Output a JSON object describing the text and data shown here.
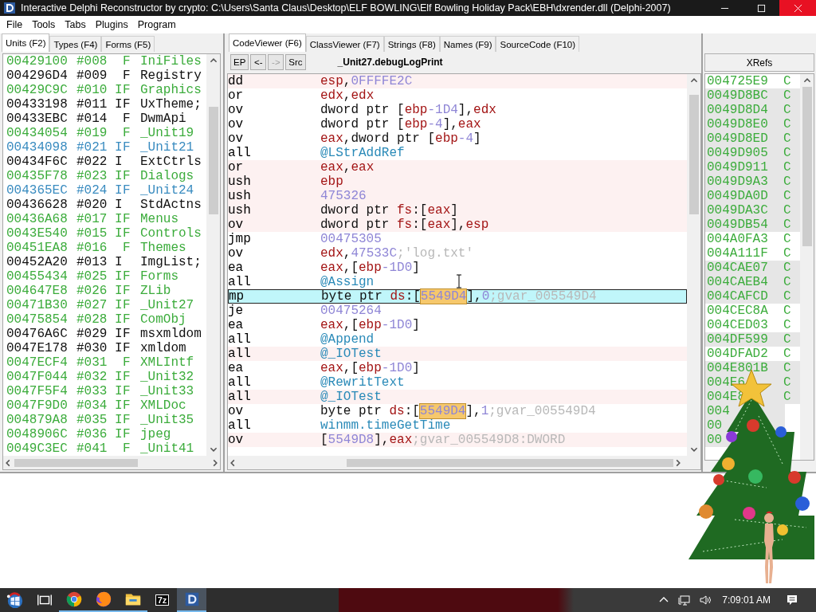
{
  "window": {
    "title": "Interactive Delphi Reconstructor by crypto: C:\\Users\\Santa Claus\\Desktop\\ELF BOWLING\\Elf Bowling Holiday Pack\\EBH\\dxrender.dll (Delphi-2007)"
  },
  "menu": [
    "File",
    "Tools",
    "Tabs",
    "Plugins",
    "Program"
  ],
  "left_tabs": [
    {
      "label": "Units (F2)",
      "selected": true
    },
    {
      "label": "Types (F4)",
      "selected": false
    },
    {
      "label": "Forms (F5)",
      "selected": false
    }
  ],
  "units": [
    {
      "address": "00429100",
      "index": "#008",
      "flag_f": "F",
      "name": "IniFiles",
      "color": "#3cac3c"
    },
    {
      "address": "004296D4",
      "index": "#009",
      "flag_f": "F",
      "name": "Registry",
      "color": "#111111"
    },
    {
      "address": "00429C9C",
      "index": "#010",
      "flag_i": "I",
      "flag_f": "F",
      "name": "Graphics",
      "color": "#3cac3c"
    },
    {
      "address": "00433198",
      "index": "#011",
      "flag_i": "I",
      "flag_f": "F",
      "name": "UxTheme;",
      "color": "#111111"
    },
    {
      "address": "00433EBC",
      "index": "#014",
      "flag_f": "F",
      "name": "DwmApi",
      "color": "#111111"
    },
    {
      "address": "00434054",
      "index": "#019",
      "flag_f": "F",
      "name": "_Unit19",
      "color": "#3cac3c"
    },
    {
      "address": "00434098",
      "index": "#021",
      "flag_i": "I",
      "flag_f": "F",
      "name": "_Unit21",
      "color": "#3a8cc0"
    },
    {
      "address": "00434F6C",
      "index": "#022",
      "flag_i": "I",
      "name": "ExtCtrls",
      "color": "#111111"
    },
    {
      "address": "00435F78",
      "index": "#023",
      "flag_i": "I",
      "flag_f": "F",
      "name": "Dialogs",
      "color": "#3cac3c"
    },
    {
      "address": "004365EC",
      "index": "#024",
      "flag_i": "I",
      "flag_f": "F",
      "name": "_Unit24",
      "color": "#3a8cc0"
    },
    {
      "address": "00436628",
      "index": "#020",
      "flag_i": "I",
      "name": "StdActns",
      "color": "#111111"
    },
    {
      "address": "00436A68",
      "index": "#017",
      "flag_i": "I",
      "flag_f": "F",
      "name": "Menus",
      "color": "#3cac3c"
    },
    {
      "address": "0043E540",
      "index": "#015",
      "flag_i": "I",
      "flag_f": "F",
      "name": "Controls",
      "color": "#3cac3c"
    },
    {
      "address": "00451EA8",
      "index": "#016",
      "flag_f": "F",
      "name": "Themes",
      "color": "#3cac3c"
    },
    {
      "address": "00452A20",
      "index": "#013",
      "flag_i": "I",
      "name": "ImgList;",
      "color": "#111111"
    },
    {
      "address": "00455434",
      "index": "#025",
      "flag_i": "I",
      "flag_f": "F",
      "name": "Forms",
      "color": "#3cac3c"
    },
    {
      "address": "004647E8",
      "index": "#026",
      "flag_i": "I",
      "flag_f": "F",
      "name": "ZLib",
      "color": "#3cac3c"
    },
    {
      "address": "00471B30",
      "index": "#027",
      "flag_i": "I",
      "flag_f": "F",
      "name": "_Unit27",
      "color": "#3cac3c"
    },
    {
      "address": "00475854",
      "index": "#028",
      "flag_i": "I",
      "flag_f": "F",
      "name": "ComObj",
      "color": "#3cac3c"
    },
    {
      "address": "00476A6C",
      "index": "#029",
      "flag_i": "I",
      "flag_f": "F",
      "name": "msxmldom",
      "color": "#111111"
    },
    {
      "address": "0047E178",
      "index": "#030",
      "flag_i": "I",
      "flag_f": "F",
      "name": "xmldom",
      "color": "#111111"
    },
    {
      "address": "0047ECF4",
      "index": "#031",
      "flag_f": "F",
      "name": "XMLIntf",
      "color": "#3cac3c"
    },
    {
      "address": "0047F044",
      "index": "#032",
      "flag_i": "I",
      "flag_f": "F",
      "name": "_Unit32",
      "color": "#3cac3c"
    },
    {
      "address": "0047F5F4",
      "index": "#033",
      "flag_i": "I",
      "flag_f": "F",
      "name": "_Unit33",
      "color": "#3cac3c"
    },
    {
      "address": "0047F9D0",
      "index": "#034",
      "flag_i": "I",
      "flag_f": "F",
      "name": "XMLDoc",
      "color": "#3cac3c"
    },
    {
      "address": "004879A8",
      "index": "#035",
      "flag_i": "I",
      "flag_f": "F",
      "name": "_Unit35",
      "color": "#3cac3c"
    },
    {
      "address": "0048906C",
      "index": "#036",
      "flag_i": "I",
      "flag_f": "F",
      "name": "jpeg",
      "color": "#3cac3c"
    },
    {
      "address": "0049C3EC",
      "index": "#041",
      "flag_f": "F",
      "name": "_Unit41",
      "color": "#3cac3c"
    }
  ],
  "code_tabs": [
    {
      "label": "CodeViewer (F6)",
      "selected": true
    },
    {
      "label": "ClassViewer (F7)",
      "selected": false
    },
    {
      "label": "Strings (F8)",
      "selected": false
    },
    {
      "label": "Names (F9)",
      "selected": false
    },
    {
      "label": "SourceCode (F10)",
      "selected": false
    }
  ],
  "toolbar": {
    "buttons": [
      {
        "label": "EP",
        "disabled": false
      },
      {
        "label": "<-",
        "disabled": false
      },
      {
        "label": "->",
        "disabled": true
      },
      {
        "label": "Src",
        "disabled": false
      }
    ],
    "procedure": "_Unit27.debugLogPrint"
  },
  "code": [
    {
      "mnemonic": "dd",
      "shaded": true,
      "selected": false,
      "operand": [
        {
          "kind": "reg",
          "text": "esp"
        },
        {
          "kind": "txt",
          "text": ","
        },
        {
          "kind": "num",
          "text": "0FFFFE2C"
        }
      ]
    },
    {
      "mnemonic": "or",
      "shaded": false,
      "selected": false,
      "operand": [
        {
          "kind": "reg",
          "text": "edx"
        },
        {
          "kind": "txt",
          "text": ","
        },
        {
          "kind": "reg",
          "text": "edx"
        }
      ]
    },
    {
      "mnemonic": "ov",
      "shaded": false,
      "selected": false,
      "operand": [
        {
          "kind": "txt",
          "text": "dword ptr ["
        },
        {
          "kind": "reg",
          "text": "ebp"
        },
        {
          "kind": "num",
          "text": "-1D4"
        },
        {
          "kind": "txt",
          "text": "],"
        },
        {
          "kind": "reg",
          "text": "edx"
        }
      ]
    },
    {
      "mnemonic": "ov",
      "shaded": false,
      "selected": false,
      "operand": [
        {
          "kind": "txt",
          "text": "dword ptr ["
        },
        {
          "kind": "reg",
          "text": "ebp"
        },
        {
          "kind": "num",
          "text": "-4"
        },
        {
          "kind": "txt",
          "text": "],"
        },
        {
          "kind": "reg",
          "text": "eax"
        }
      ]
    },
    {
      "mnemonic": "ov",
      "shaded": false,
      "selected": false,
      "operand": [
        {
          "kind": "reg",
          "text": "eax"
        },
        {
          "kind": "txt",
          "text": ",dword ptr ["
        },
        {
          "kind": "reg",
          "text": "ebp"
        },
        {
          "kind": "num",
          "text": "-4"
        },
        {
          "kind": "txt",
          "text": "]"
        }
      ]
    },
    {
      "mnemonic": "all",
      "shaded": false,
      "selected": false,
      "operand": [
        {
          "kind": "name",
          "text": "@LStrAddRef"
        }
      ]
    },
    {
      "mnemonic": "or",
      "shaded": true,
      "selected": false,
      "operand": [
        {
          "kind": "reg",
          "text": "eax"
        },
        {
          "kind": "txt",
          "text": ","
        },
        {
          "kind": "reg",
          "text": "eax"
        }
      ]
    },
    {
      "mnemonic": "ush",
      "shaded": true,
      "selected": false,
      "operand": [
        {
          "kind": "reg",
          "text": "ebp"
        }
      ]
    },
    {
      "mnemonic": "ush",
      "shaded": true,
      "selected": false,
      "operand": [
        {
          "kind": "num",
          "text": "475326"
        }
      ]
    },
    {
      "mnemonic": "ush",
      "shaded": true,
      "selected": false,
      "operand": [
        {
          "kind": "txt",
          "text": "dword ptr "
        },
        {
          "kind": "reg",
          "text": "fs"
        },
        {
          "kind": "txt",
          "text": ":["
        },
        {
          "kind": "reg",
          "text": "eax"
        },
        {
          "kind": "txt",
          "text": "]"
        }
      ]
    },
    {
      "mnemonic": "ov",
      "shaded": true,
      "selected": false,
      "operand": [
        {
          "kind": "txt",
          "text": "dword ptr "
        },
        {
          "kind": "reg",
          "text": "fs"
        },
        {
          "kind": "txt",
          "text": ":["
        },
        {
          "kind": "reg",
          "text": "eax"
        },
        {
          "kind": "txt",
          "text": "],"
        },
        {
          "kind": "reg",
          "text": "esp"
        }
      ]
    },
    {
      "mnemonic": "jmp",
      "shaded": false,
      "selected": false,
      "operand": [
        {
          "kind": "num",
          "text": "00475305"
        }
      ]
    },
    {
      "mnemonic": "ov",
      "shaded": false,
      "selected": false,
      "operand": [
        {
          "kind": "reg",
          "text": "edx"
        },
        {
          "kind": "txt",
          "text": ","
        },
        {
          "kind": "num",
          "text": "47533C"
        },
        {
          "kind": "cmt",
          "text": ";'log.txt'"
        }
      ]
    },
    {
      "mnemonic": "ea",
      "shaded": false,
      "selected": false,
      "operand": [
        {
          "kind": "reg",
          "text": "eax"
        },
        {
          "kind": "txt",
          "text": ",["
        },
        {
          "kind": "reg",
          "text": "ebp"
        },
        {
          "kind": "num",
          "text": "-1D0"
        },
        {
          "kind": "txt",
          "text": "]"
        }
      ]
    },
    {
      "mnemonic": "all",
      "shaded": false,
      "selected": false,
      "operand": [
        {
          "kind": "name",
          "text": "@Assign"
        }
      ]
    },
    {
      "mnemonic": "mp",
      "shaded": false,
      "selected": true,
      "operand": [
        {
          "kind": "txt",
          "text": "byte ptr "
        },
        {
          "kind": "reg",
          "text": "ds"
        },
        {
          "kind": "txt",
          "text": ":["
        },
        {
          "kind": "hl",
          "text": "5549D4"
        },
        {
          "kind": "txt",
          "text": "],"
        },
        {
          "kind": "num",
          "text": "0"
        },
        {
          "kind": "cmt",
          "text": ";gvar_005549D4"
        }
      ]
    },
    {
      "mnemonic": "je",
      "shaded": false,
      "selected": false,
      "operand": [
        {
          "kind": "num",
          "text": "00475264"
        }
      ]
    },
    {
      "mnemonic": "ea",
      "shaded": false,
      "selected": false,
      "operand": [
        {
          "kind": "reg",
          "text": "eax"
        },
        {
          "kind": "txt",
          "text": ",["
        },
        {
          "kind": "reg",
          "text": "ebp"
        },
        {
          "kind": "num",
          "text": "-1D0"
        },
        {
          "kind": "txt",
          "text": "]"
        }
      ]
    },
    {
      "mnemonic": "all",
      "shaded": false,
      "selected": false,
      "operand": [
        {
          "kind": "name",
          "text": "@Append"
        }
      ]
    },
    {
      "mnemonic": "all",
      "shaded": true,
      "selected": false,
      "operand": [
        {
          "kind": "name",
          "text": "@_IOTest"
        }
      ]
    },
    {
      "mnemonic": "ea",
      "shaded": false,
      "selected": false,
      "operand": [
        {
          "kind": "reg",
          "text": "eax"
        },
        {
          "kind": "txt",
          "text": ",["
        },
        {
          "kind": "reg",
          "text": "ebp"
        },
        {
          "kind": "num",
          "text": "-1D0"
        },
        {
          "kind": "txt",
          "text": "]"
        }
      ]
    },
    {
      "mnemonic": "all",
      "shaded": false,
      "selected": false,
      "operand": [
        {
          "kind": "name",
          "text": "@RewritText"
        }
      ]
    },
    {
      "mnemonic": "all",
      "shaded": true,
      "selected": false,
      "operand": [
        {
          "kind": "name",
          "text": "@_IOTest"
        }
      ]
    },
    {
      "mnemonic": "ov",
      "shaded": false,
      "selected": false,
      "operand": [
        {
          "kind": "txt",
          "text": "byte ptr "
        },
        {
          "kind": "reg",
          "text": "ds"
        },
        {
          "kind": "txt",
          "text": ":["
        },
        {
          "kind": "hl",
          "text": "5549D4"
        },
        {
          "kind": "txt",
          "text": "],"
        },
        {
          "kind": "num",
          "text": "1"
        },
        {
          "kind": "cmt",
          "text": ";gvar_005549D4"
        }
      ]
    },
    {
      "mnemonic": "all",
      "shaded": false,
      "selected": false,
      "operand": [
        {
          "kind": "name",
          "text": "winmm.timeGetTime"
        }
      ]
    },
    {
      "mnemonic": "ov",
      "shaded": true,
      "selected": false,
      "operand": [
        {
          "kind": "txt",
          "text": "["
        },
        {
          "kind": "num",
          "text": "5549D8"
        },
        {
          "kind": "txt",
          "text": "],"
        },
        {
          "kind": "reg",
          "text": "eax"
        },
        {
          "kind": "cmt",
          "text": ";gvar_005549D8:DWORD"
        }
      ]
    }
  ],
  "xrefs": {
    "title": "XRefs",
    "rows": [
      {
        "address": "004725E9",
        "type": "C",
        "shaded": false
      },
      {
        "address": "0049D8BC",
        "type": "C",
        "shaded": true
      },
      {
        "address": "0049D8D4",
        "type": "C",
        "shaded": true
      },
      {
        "address": "0049D8E0",
        "type": "C",
        "shaded": true
      },
      {
        "address": "0049D8ED",
        "type": "C",
        "shaded": true
      },
      {
        "address": "0049D905",
        "type": "C",
        "shaded": true
      },
      {
        "address": "0049D911",
        "type": "C",
        "shaded": true
      },
      {
        "address": "0049D9A3",
        "type": "C",
        "shaded": true
      },
      {
        "address": "0049DA0D",
        "type": "C",
        "shaded": true
      },
      {
        "address": "0049DA3C",
        "type": "C",
        "shaded": true
      },
      {
        "address": "0049DB54",
        "type": "C",
        "shaded": true
      },
      {
        "address": "004A0FA3",
        "type": "C",
        "shaded": false
      },
      {
        "address": "004A111F",
        "type": "C",
        "shaded": false
      },
      {
        "address": "004CAE07",
        "type": "C",
        "shaded": true
      },
      {
        "address": "004CAEB4",
        "type": "C",
        "shaded": true
      },
      {
        "address": "004CAFCD",
        "type": "C",
        "shaded": true
      },
      {
        "address": "004CEC8A",
        "type": "C",
        "shaded": false
      },
      {
        "address": "004CED03",
        "type": "C",
        "shaded": false
      },
      {
        "address": "004DF599",
        "type": "C",
        "shaded": true
      },
      {
        "address": "004DFAD2",
        "type": "C",
        "shaded": false
      },
      {
        "address": "004E801B",
        "type": "C",
        "shaded": true
      },
      {
        "address": "004E6",
        "type": "C",
        "shaded": true
      },
      {
        "address": "004E8",
        "type": "C",
        "shaded": true
      },
      {
        "address": "004",
        "shaded": true
      },
      {
        "address": "00",
        "shaded": true
      },
      {
        "address": "00",
        "shaded": true
      }
    ]
  },
  "taskbar": {
    "items": [
      {
        "kind": "start",
        "running": false,
        "active": false
      },
      {
        "kind": "task-view",
        "running": false,
        "active": false
      },
      {
        "kind": "round-browser",
        "running": true,
        "active": false
      },
      {
        "kind": "fox-browser",
        "running": true,
        "active": false
      },
      {
        "kind": "folder",
        "running": true,
        "active": false
      },
      {
        "kind": "archive",
        "label": "7z",
        "running": false,
        "active": false
      },
      {
        "kind": "reconstructor",
        "running": true,
        "active": true
      }
    ],
    "clock": "7:09:01 AM"
  }
}
